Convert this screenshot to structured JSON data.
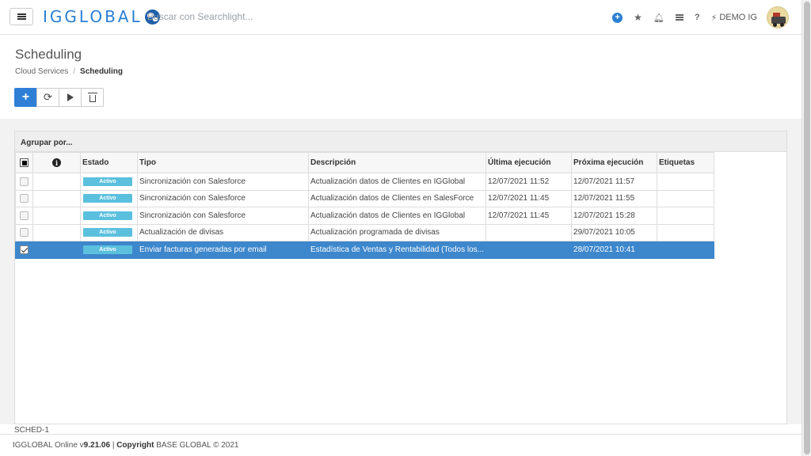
{
  "app": {
    "logo_text": "IGGLOBAL",
    "search_placeholder": "Buscar con Searchlight...",
    "user_label": "DEMO IG"
  },
  "icons": {
    "menu": "hamburger-icon",
    "add": "plus-circle-icon",
    "favorites": "star-icon",
    "notifications": "bell-icon",
    "list": "list-icon",
    "help": "question-icon",
    "user": "plug-icon"
  },
  "colors": {
    "accent": "#2f7fd6",
    "selected_row": "#3d87cc",
    "badge": "#5bc0de"
  },
  "header": {
    "title": "Scheduling",
    "breadcrumb": [
      "Cloud Services",
      "Scheduling"
    ],
    "breadcrumb_sep": "/"
  },
  "toolbar": {
    "add": "+",
    "refresh": "⟳"
  },
  "grid": {
    "group_by": "Agrupar por...",
    "columns": [
      "",
      "i",
      "Estado",
      "Tipo",
      "Descripción",
      "Última ejecución",
      "Próxima ejecución",
      "Etiquetas"
    ],
    "rows": [
      {
        "checked": false,
        "estado": "Activo",
        "tipo": "Sincronización con Salesforce",
        "descripcion": "Actualización datos de Clientes en IGGlobal",
        "ultima": "12/07/2021 11:52",
        "proxima": "12/07/2021 11:57",
        "etiquetas": ""
      },
      {
        "checked": false,
        "estado": "Activo",
        "tipo": "Sincronización con Salesforce",
        "descripcion": "Actualización datos de Clientes en SalesForce",
        "ultima": "12/07/2021 11:45",
        "proxima": "12/07/2021 11:55",
        "etiquetas": ""
      },
      {
        "checked": false,
        "estado": "Activo",
        "tipo": "Sincronización con Salesforce",
        "descripcion": "Actualización datos de Clientes en IGGlobal",
        "ultima": "12/07/2021 11:45",
        "proxima": "12/07/2021 15:28",
        "etiquetas": ""
      },
      {
        "checked": false,
        "estado": "Activo",
        "tipo": "Actualización de divisas",
        "descripcion": "Actualización programada de divisas",
        "ultima": "",
        "proxima": "29/07/2021 10:05",
        "etiquetas": ""
      },
      {
        "checked": true,
        "estado": "Activo",
        "tipo": "Enviar facturas generadas por email",
        "descripcion": "Estadística de Ventas y Rentabilidad (Todos los...",
        "ultima": "",
        "proxima": "28/07/2021 10:41",
        "etiquetas": ""
      }
    ]
  },
  "footer": {
    "screen_id": "SCHED-1",
    "app_name": "IGGLOBAL Online v",
    "version": "9.21.06",
    "sep": " | ",
    "copyright_label": "Copyright",
    "copyright_text": " BASE GLOBAL © 2021"
  }
}
